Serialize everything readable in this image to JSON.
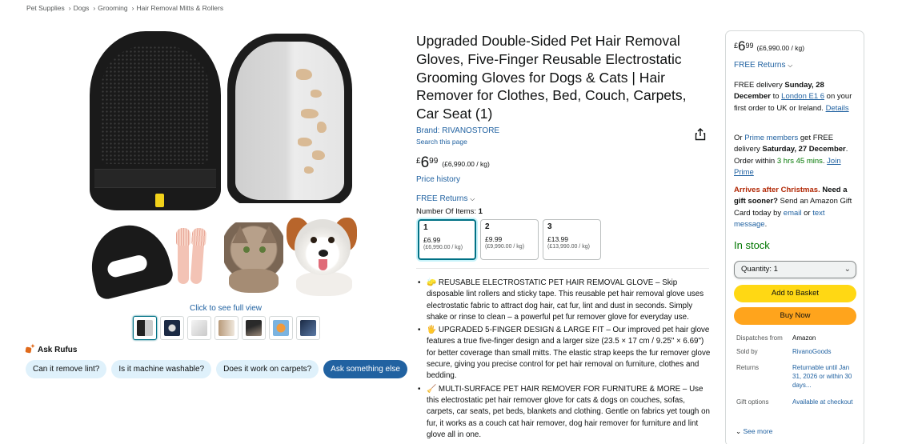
{
  "breadcrumb": [
    "Pet Supplies",
    "Dogs",
    "Grooming",
    "Hair Removal Mitts & Rollers"
  ],
  "breadcrumb_separator": "›",
  "gallery": {
    "click_full": "Click to see full view",
    "thumb_count": 7
  },
  "rufus": {
    "label": "Ask Rufus",
    "chips": [
      "Can it remove lint?",
      "Is it machine washable?",
      "Does it work on carpets?",
      "Ask something else"
    ]
  },
  "product": {
    "title": "Upgraded Double-Sided Pet Hair Removal Gloves, Five-Finger Reusable Electrostatic Grooming Gloves for Dogs & Cats | Hair Remover for Clothes, Bed, Couch, Carpets, Car Seat (1)",
    "brand": "Brand: RIVANOSTORE",
    "search_page": "Search this page",
    "price_currency": "£",
    "price_whole": "6",
    "price_fraction": "99",
    "price_unit": "(£6,990.00 / kg)",
    "price_history": "Price history",
    "free_returns": "FREE Returns",
    "num_items_label": "Number Of Items:",
    "num_items_value": "1",
    "options": [
      {
        "n": "1",
        "price": "£6.99",
        "unit": "(£6,990.00 / kg)"
      },
      {
        "n": "2",
        "price": "£9.99",
        "unit": "(£9,990.00 / kg)"
      },
      {
        "n": "3",
        "price": "£13.99",
        "unit": "(£13,990.00 / kg)"
      }
    ],
    "bullets": [
      "🧽 REUSABLE ELECTROSTATIC PET HAIR REMOVAL GLOVE – Skip disposable lint rollers and sticky tape. This reusable pet hair removal glove uses electrostatic fabric to attract dog hair, cat fur, lint and dust in seconds. Simply shake or rinse to clean – a powerful pet fur remover glove for everyday use.",
      "🖐 UPGRADED 5-FINGER DESIGN & LARGE FIT – Our improved pet hair glove features a true five-finger design and a larger size (23.5 × 17 cm / 9.25\" × 6.69\") for better coverage than small mitts. The elastic strap keeps the fur remover glove secure, giving you precise control for pet hair removal on furniture, clothes and bedding.",
      "🧹 MULTI-SURFACE PET HAIR REMOVER FOR FURNITURE & MORE – Use this electrostatic pet hair remover glove for cats & dogs on couches, sofas, carpets, car seats, pet beds, blankets and clothing. Gentle on fabrics yet tough on fur, it works as a couch cat hair remover, dog hair remover for furniture and lint glove all in one."
    ]
  },
  "buybox": {
    "price_currency": "£",
    "price_whole": "6",
    "price_fraction": "99",
    "price_unit": "(£6,990.00 / kg)",
    "free_returns": "FREE Returns",
    "delivery": {
      "prefix": "FREE delivery ",
      "date": "Sunday, 28 December",
      "to": " to ",
      "location": "London E1 6",
      "suffix": " on your first order to UK or Ireland. ",
      "details": "Details"
    },
    "prime": {
      "prefix": "Or ",
      "members": "Prime members",
      "mid": " get FREE delivery ",
      "date": "Saturday, 27 December",
      "order_within": ". Order within ",
      "countdown": "3 hrs 45 mins",
      "join": "Join Prime"
    },
    "xmas": {
      "alert": "Arrives after Christmas.",
      "sooner": " Need a gift sooner?",
      "text": " Send an Amazon Gift Card today by ",
      "email": "email",
      "or": " or ",
      "message": "text message",
      "end": "."
    },
    "stock": "In stock",
    "quantity": "Quantity: 1",
    "add_to_basket": "Add to Basket",
    "buy_now": "Buy Now",
    "info": [
      {
        "k": "Dispatches from",
        "v": "Amazon",
        "link": false
      },
      {
        "k": "Sold by",
        "v": "RivanoGoods",
        "link": true
      },
      {
        "k": "Returns",
        "v": "Returnable until Jan 31, 2026 or within 30 days...",
        "link": true
      },
      {
        "k": "Gift options",
        "v": "Available at checkout",
        "link": true
      }
    ],
    "see_more": "See more"
  },
  "colors": {
    "link": "#2162a1",
    "add_to_basket": "#ffd814",
    "buy_now": "#ffa41c",
    "in_stock": "#007600",
    "alert": "#b12704",
    "chip": "#dff1fb",
    "chip_dark": "#2162a1"
  }
}
